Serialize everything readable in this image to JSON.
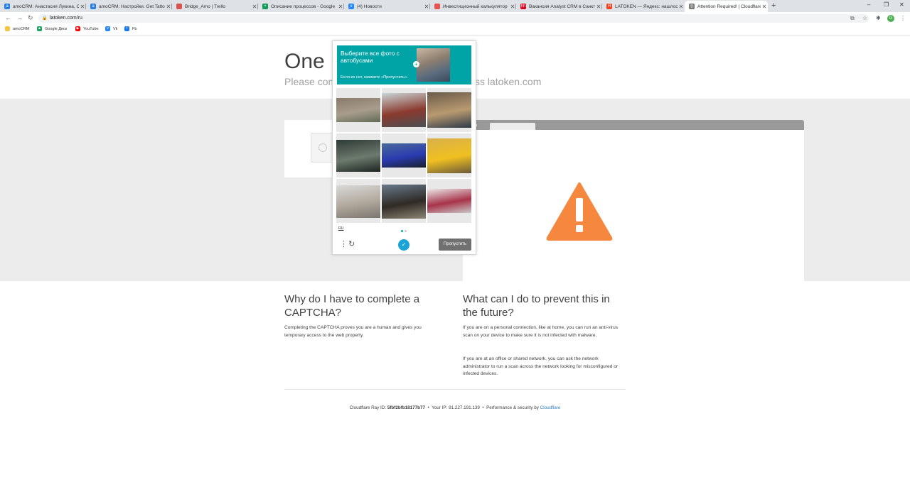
{
  "browser": {
    "tabs": [
      {
        "title": "amoCRM: Анастасия Лукина, Ст",
        "color": "#2a7de1",
        "glyph": "a"
      },
      {
        "title": "amoCRM: Настройки. Get Tattoo",
        "color": "#2a7de1",
        "glyph": "a"
      },
      {
        "title": "Bridge_Amo | Trello",
        "color": "#d9534f",
        "glyph": ""
      },
      {
        "title": "Описание процессов - Google",
        "color": "#0f9d58",
        "glyph": "+"
      },
      {
        "title": "(4) Новости",
        "color": "#2787f5",
        "glyph": "v"
      },
      {
        "title": "Инвестиционный калькулятор",
        "color": "#e8554e",
        "glyph": ""
      },
      {
        "title": "Вакансия Analyst CRM в Санкт-",
        "color": "#d6001c",
        "glyph": "hh"
      },
      {
        "title": "LATOKEN — Яндекс: нашлось 5",
        "color": "#fc3f1d",
        "glyph": "Я"
      },
      {
        "title": "Attention Required! | Cloudflare",
        "color": "#777777",
        "glyph": "◎"
      }
    ],
    "url": "latoken.com/ru",
    "avatar_letter": "G",
    "bookmarks": [
      {
        "label": "amoCRM",
        "color": "#f4c542",
        "glyph": ""
      },
      {
        "label": "Google Диск",
        "color": "#1fa463",
        "glyph": "▲"
      },
      {
        "label": "YouTube",
        "color": "#ff0000",
        "glyph": "▶"
      },
      {
        "label": "Vk",
        "color": "#2787f5",
        "glyph": "v"
      },
      {
        "label": "Fb",
        "color": "#1877f2",
        "glyph": "f"
      }
    ]
  },
  "page": {
    "heading_visible": "One m",
    "subtitle_left": "Please com",
    "subtitle_right": "ss latoken.com",
    "why_heading": "Why do I have to complete a CAPTCHA?",
    "why_text": "Completing the CAPTCHA proves you are a human and gives you temporary access to the web property.",
    "prevent_heading": "What can I do to prevent this in the future?",
    "prevent_text_1": "If you are on a personal connection, like at home, you can run an anti-virus scan on your device to make sure it is not infected with malware.",
    "prevent_text_2": "If you are at an office or shared network, you can ask the network administrator to run a scan across the network looking for misconfigured or infected devices.",
    "footer": {
      "ray_label": "Cloudflare Ray ID:",
      "ray_id": "5fbf2bfb18177b77",
      "ip_label": "Your IP:",
      "ip": "91.227.191.139",
      "perf_label": "Performance & security by",
      "cloudflare_link": "Cloudflare",
      "separator": "•"
    },
    "warning_color": "#f6873f"
  },
  "captcha": {
    "title": "Выберите все фото с автобусами",
    "hint": "Если их нет, нажмите «Пропустить».",
    "accent": "#00a4a6",
    "language": "RU",
    "skip_label": "Пропустить",
    "tiles": [
      {
        "name": "tile-1",
        "colors": [
          "#8a7b6a",
          "#a89c8c",
          "#5f6a55"
        ]
      },
      {
        "name": "tile-2",
        "colors": [
          "#c9d5d8",
          "#8b3a2e",
          "#4a4f55"
        ]
      },
      {
        "name": "tile-3",
        "colors": [
          "#6a5a4a",
          "#b89a70",
          "#2f3a4a"
        ]
      },
      {
        "name": "tile-4",
        "colors": [
          "#2e3a36",
          "#6d7a6e",
          "#1c2420"
        ]
      },
      {
        "name": "tile-5",
        "colors": [
          "#4a6a9a",
          "#2a3bb0",
          "#1a1f2a"
        ]
      },
      {
        "name": "tile-6",
        "colors": [
          "#d8b04a",
          "#f0c020",
          "#6b5a3a"
        ]
      },
      {
        "name": "tile-7",
        "colors": [
          "#d9d9d9",
          "#b0a89c",
          "#7a7570"
        ]
      },
      {
        "name": "tile-8",
        "colors": [
          "#6a7a8c",
          "#2f2a25",
          "#8c8575"
        ]
      },
      {
        "name": "tile-9",
        "colors": [
          "#e8e8e8",
          "#a8334a",
          "#c8c8c8"
        ]
      }
    ]
  }
}
